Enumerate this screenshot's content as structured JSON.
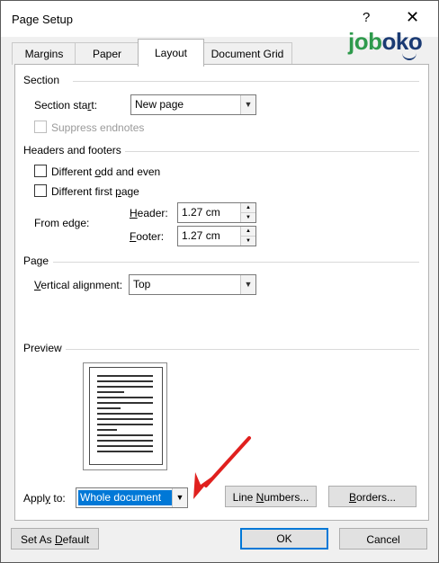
{
  "window": {
    "title": "Page Setup",
    "help_glyph": "?",
    "close_glyph": "✕"
  },
  "tabs": [
    {
      "label": "Margins"
    },
    {
      "label": "Paper"
    },
    {
      "label": "Layout"
    },
    {
      "label": "Document Grid"
    }
  ],
  "active_tab": "Layout",
  "logo": {
    "part1": "job",
    "part2": "oko",
    "color1": "#2e9a4c",
    "color2": "#1a3a73"
  },
  "section": {
    "heading": "Section",
    "start_label": "Section start:",
    "start_value": "New page",
    "suppress_endnotes_label": "Suppress endnotes",
    "suppress_endnotes_checked": false,
    "suppress_endnotes_enabled": false
  },
  "headers_footers": {
    "heading": "Headers and footers",
    "different_odd_even_label": "Different odd and even",
    "different_odd_even_checked": false,
    "different_first_page_label": "Different first page",
    "different_first_page_checked": false,
    "from_edge_label": "From edge:",
    "header_label": "Header:",
    "header_value": "1.27 cm",
    "footer_label": "Footer:",
    "footer_value": "1.27 cm"
  },
  "page": {
    "heading": "Page",
    "vertical_alignment_label": "Vertical alignment:",
    "vertical_alignment_value": "Top"
  },
  "preview": {
    "heading": "Preview"
  },
  "apply": {
    "label": "Apply to:",
    "value": "Whole document",
    "line_numbers_button": "Line Numbers...",
    "borders_button": "Borders..."
  },
  "footer_buttons": {
    "set_default": "Set As Default",
    "ok": "OK",
    "cancel": "Cancel"
  },
  "colors": {
    "selection": "#0078d7",
    "annotation_arrow": "#e0201e"
  }
}
